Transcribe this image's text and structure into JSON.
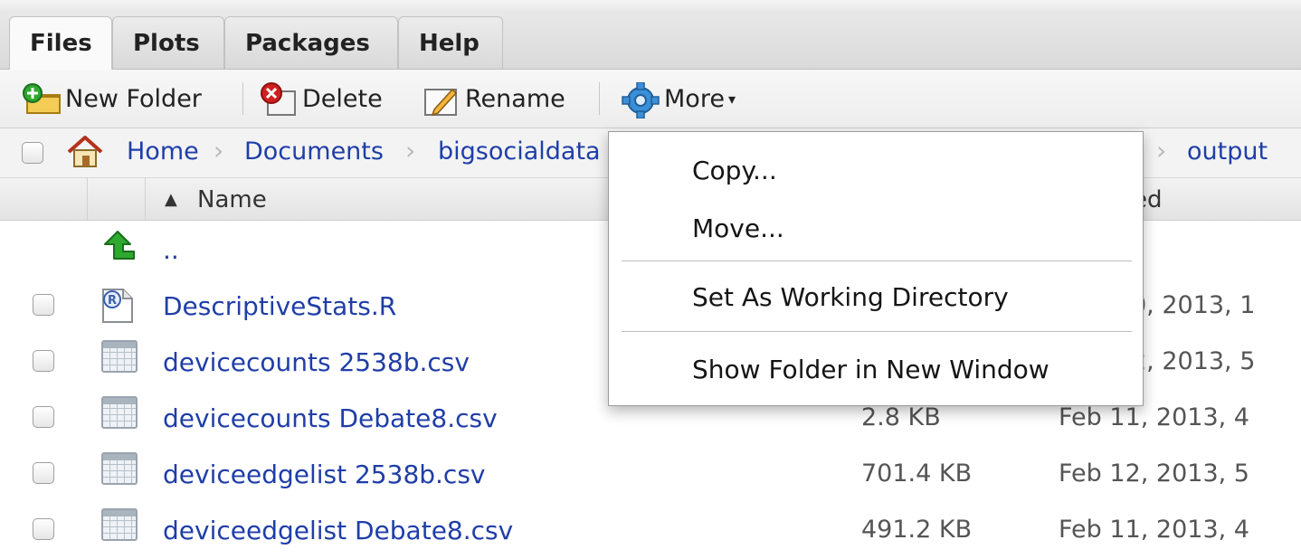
{
  "tabs": [
    {
      "label": "Files",
      "active": true
    },
    {
      "label": "Plots",
      "active": false
    },
    {
      "label": "Packages",
      "active": false
    },
    {
      "label": "Help",
      "active": false
    }
  ],
  "toolbar": {
    "new_folder": "New Folder",
    "delete": "Delete",
    "rename": "Rename",
    "more": "More",
    "more_caret": "▾"
  },
  "breadcrumb": {
    "items": [
      "Home",
      "Documents",
      "bigsocialdata",
      "output"
    ],
    "separator": "›"
  },
  "table": {
    "sort_indicator": "▲",
    "name_header": "Name",
    "modified_header_visible": "ed",
    "parent_row": "..",
    "files": [
      {
        "name": "DescriptiveStats.R",
        "size": "",
        "modified": "0, 2013, 1"
      },
      {
        "name": "devicecounts 2538b.csv",
        "size": "",
        "modified": "2, 2013, 5"
      },
      {
        "name": "devicecounts Debate8.csv",
        "size": "2.8 KB",
        "modified": "Feb 11, 2013, 4"
      },
      {
        "name": "deviceedgelist 2538b.csv",
        "size": "701.4 KB",
        "modified": "Feb 12, 2013, 5"
      },
      {
        "name": "deviceedgelist Debate8.csv",
        "size": "491.2 KB",
        "modified": "Feb 11, 2013, 4"
      }
    ]
  },
  "menu": {
    "copy": "Copy...",
    "move": "Move...",
    "set_wd": "Set As Working Directory",
    "show_folder": "Show Folder in New Window"
  },
  "colors": {
    "link": "#1f3ea8",
    "up_arrow": "#2fa82f",
    "delete_red": "#d02020",
    "gear_blue": "#3b8fd6"
  }
}
